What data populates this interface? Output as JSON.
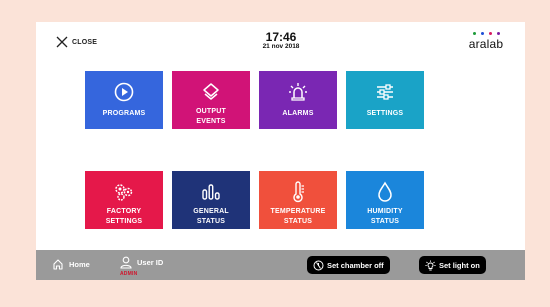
{
  "header": {
    "close_label": "CLOSE",
    "time": "17:46",
    "date": "21 nov 2018",
    "brand": "aralab",
    "brand_dot_colors": [
      "#1e9b3a",
      "#1f4fd6",
      "#d81b60",
      "#7b1fa2"
    ]
  },
  "tiles": [
    {
      "label": "PROGRAMS",
      "icon": "play-icon",
      "color": "#3566dd"
    },
    {
      "label": "OUTPUT EVENTS",
      "icon": "layers-icon",
      "color": "#d11377"
    },
    {
      "label": "ALARMS",
      "icon": "alarm-light-icon",
      "color": "#7a27b3"
    },
    {
      "label": "SETTINGS",
      "icon": "sliders-icon",
      "color": "#1aa3c7"
    },
    {
      "label": "FACTORY SETTINGS",
      "icon": "gears-icon",
      "color": "#e5184a"
    },
    {
      "label": "GENERAL STATUS",
      "icon": "bar-chart-icon",
      "color": "#1f3378"
    },
    {
      "label": "TEMPERATURE STATUS",
      "icon": "thermometer-icon",
      "color": "#f0503c"
    },
    {
      "label": "HUMIDITY STATUS",
      "icon": "water-drop-icon",
      "color": "#1b86db"
    }
  ],
  "tile_lines": [
    [
      "PROGRAMS"
    ],
    [
      "OUTPUT",
      "EVENTS"
    ],
    [
      "ALARMS"
    ],
    [
      "SETTINGS"
    ],
    [
      "FACTORY",
      "SETTINGS"
    ],
    [
      "GENERAL",
      "STATUS"
    ],
    [
      "TEMPERATURE",
      "STATUS"
    ],
    [
      "HUMIDITY",
      "STATUS"
    ]
  ],
  "bottom": {
    "home_label": "Home",
    "user_label": "User ID",
    "user_role": "ADMIN",
    "chamber_button": "Set chamber off",
    "light_button": "Set light on",
    "role_color": "#d0142c"
  }
}
